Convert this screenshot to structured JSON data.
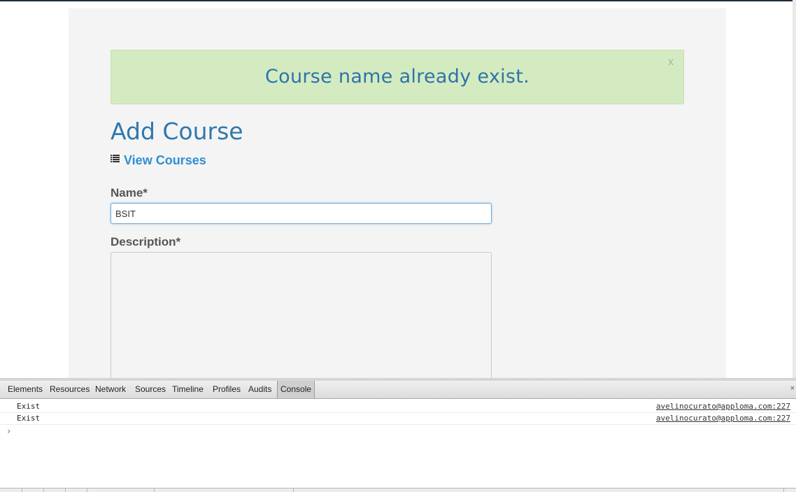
{
  "alert": {
    "message": "Course name already exist.",
    "close_label": "x"
  },
  "page": {
    "title": "Add Course",
    "view_link": "View Courses",
    "view_link_icon": "list-icon"
  },
  "form": {
    "name_label": "Name*",
    "name_value": "BSIT",
    "description_label": "Description*",
    "description_value": ""
  },
  "devtools": {
    "tabs": [
      "Elements",
      "Resources",
      "Network",
      "Sources",
      "Timeline",
      "Profiles",
      "Audits",
      "Console"
    ],
    "active_tab": "Console",
    "close_label": "×",
    "console_rows": [
      {
        "message": "Exist",
        "source": "avelinocurato@apploma.com:227"
      },
      {
        "message": "Exist",
        "source": "avelinocurato@apploma.com:227"
      }
    ],
    "prompt": "›"
  },
  "colors": {
    "alert_bg": "#d4ebc2",
    "alert_text": "#2e74a6",
    "title": "#2f78ac",
    "link": "#2d8fd0"
  }
}
